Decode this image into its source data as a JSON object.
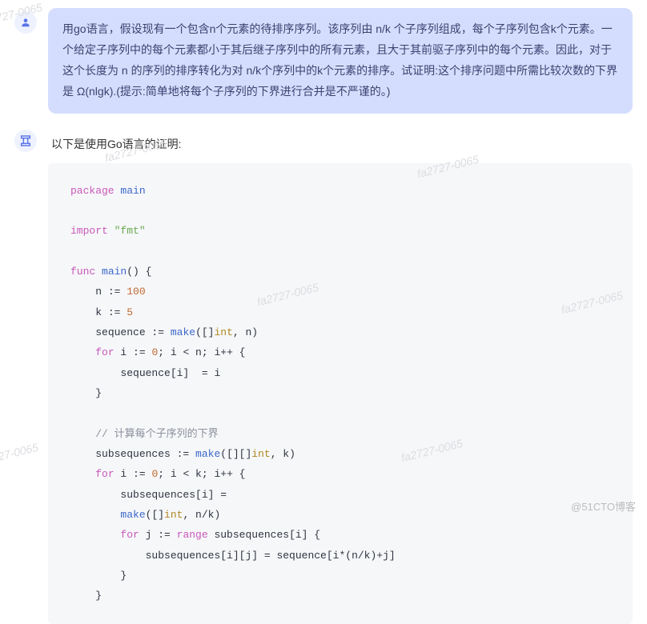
{
  "user": {
    "message": "用go语言，假设现有一个包含n个元素的待排序序列。该序列由 n/k 个子序列组成，每个子序列包含k个元素。一个给定子序列中的每个元素都小于其后继子序列中的所有元素，且大于其前驱子序列中的每个元素。因此，对于这个长度为 n 的序列的排序转化为对 n/k个序列中的k个元素的排序。试证明:这个排序问题中所需比较次数的下界是 Ω(nlgk).(提示:简单地将每个子序列的下界进行合并是不严谨的。)"
  },
  "assistant": {
    "intro": "以下是使用Go语言的证明:"
  },
  "code": {
    "l1_kw": "package",
    "l1_id": "main",
    "l2_kw": "import",
    "l2_str": "\"fmt\"",
    "l3_kw": "func",
    "l3_id": "main",
    "l3_rest": "() {",
    "l4a": "n := ",
    "l4b": "100",
    "l5a": "k := ",
    "l5b": "5",
    "l6a": "sequence := ",
    "l6b": "make",
    "l6c": "([]",
    "l6d": "int",
    "l6e": ", n)",
    "l7a": "for",
    "l7b": " i := ",
    "l7c": "0",
    "l7d": "; i < n; i++ {",
    "l8": "sequence[i]  = i",
    "l9": "}",
    "l10": "// 计算每个子序列的下界",
    "l11a": "subsequences := ",
    "l11b": "make",
    "l11c": "([][]",
    "l11d": "int",
    "l11e": ", k)",
    "l12a": "for",
    "l12b": " i := ",
    "l12c": "0",
    "l12d": "; i < k; i++ {",
    "l13": "subsequences[i] =",
    "l14a": "make",
    "l14b": "([]",
    "l14c": "int",
    "l14d": ", n/k)",
    "l15a": "for",
    "l15b": " j := ",
    "l15c": "range",
    "l15d": " subsequences[i] {",
    "l16": "subsequences[i][j] = sequence[i*(n/k)+j]",
    "l17": "}",
    "l18": "}"
  },
  "watermarks": {
    "wm": "fa2727-0065"
  },
  "brand": "@51CTO博客"
}
